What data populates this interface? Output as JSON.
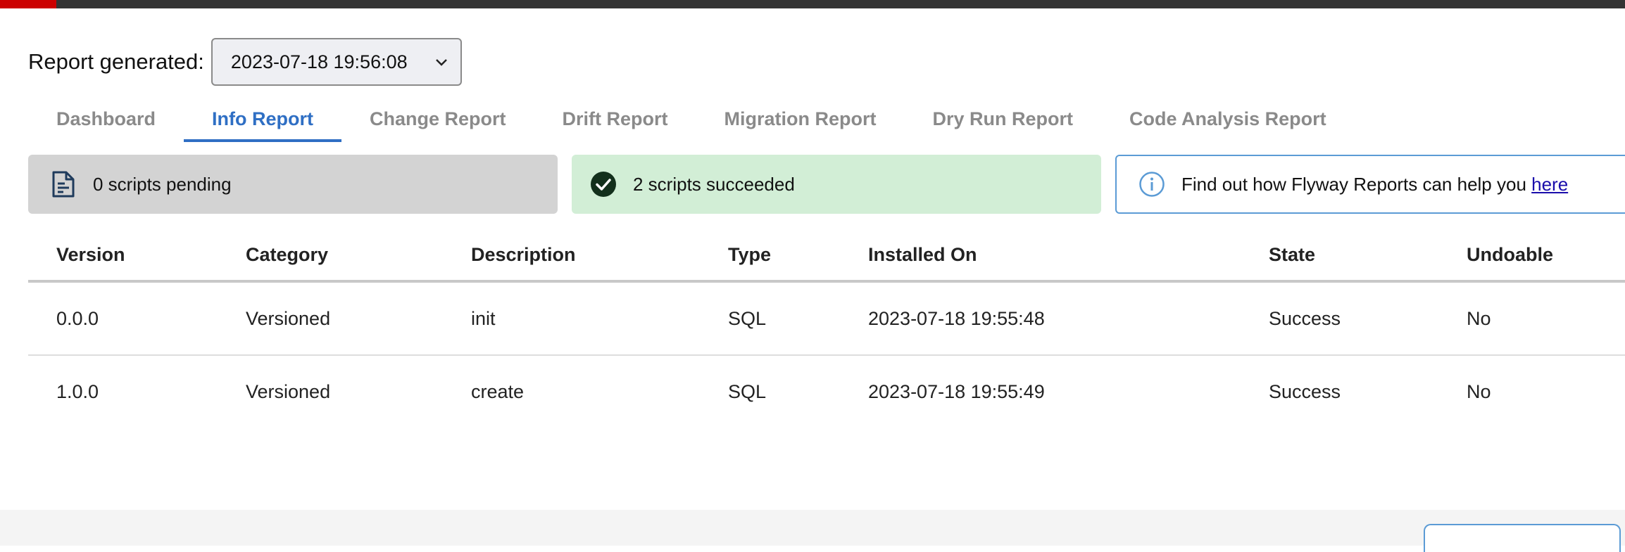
{
  "header": {
    "report_label": "Report generated:",
    "report_selected": "2023-07-18 19:56:08",
    "accent_color": "#cc0000"
  },
  "tabs": [
    {
      "label": "Dashboard",
      "active": false
    },
    {
      "label": "Info Report",
      "active": true
    },
    {
      "label": "Change Report",
      "active": false
    },
    {
      "label": "Drift Report",
      "active": false
    },
    {
      "label": "Migration Report",
      "active": false
    },
    {
      "label": "Dry Run Report",
      "active": false
    },
    {
      "label": "Code Analysis Report",
      "active": false
    }
  ],
  "cards": {
    "pending": {
      "text": "0 scripts pending",
      "icon": "document-icon"
    },
    "success": {
      "text": "2 scripts succeeded",
      "icon": "check-circle-icon"
    },
    "info": {
      "text": "Find out how Flyway Reports can help you ",
      "link": "here",
      "icon": "info-icon"
    }
  },
  "table": {
    "columns": [
      "Version",
      "Category",
      "Description",
      "Type",
      "Installed On",
      "State",
      "Undoable"
    ],
    "rows": [
      [
        "0.0.0",
        "Versioned",
        "init",
        "SQL",
        "2023-07-18 19:55:48",
        "Success",
        "No"
      ],
      [
        "1.0.0",
        "Versioned",
        "create",
        "SQL",
        "2023-07-18 19:55:49",
        "Success",
        "No"
      ]
    ]
  },
  "colors": {
    "active_tab": "#2f6fc4",
    "pending_bg": "#d3d3d3",
    "success_bg": "#d2eed6",
    "info_border": "#5b9bd5"
  }
}
